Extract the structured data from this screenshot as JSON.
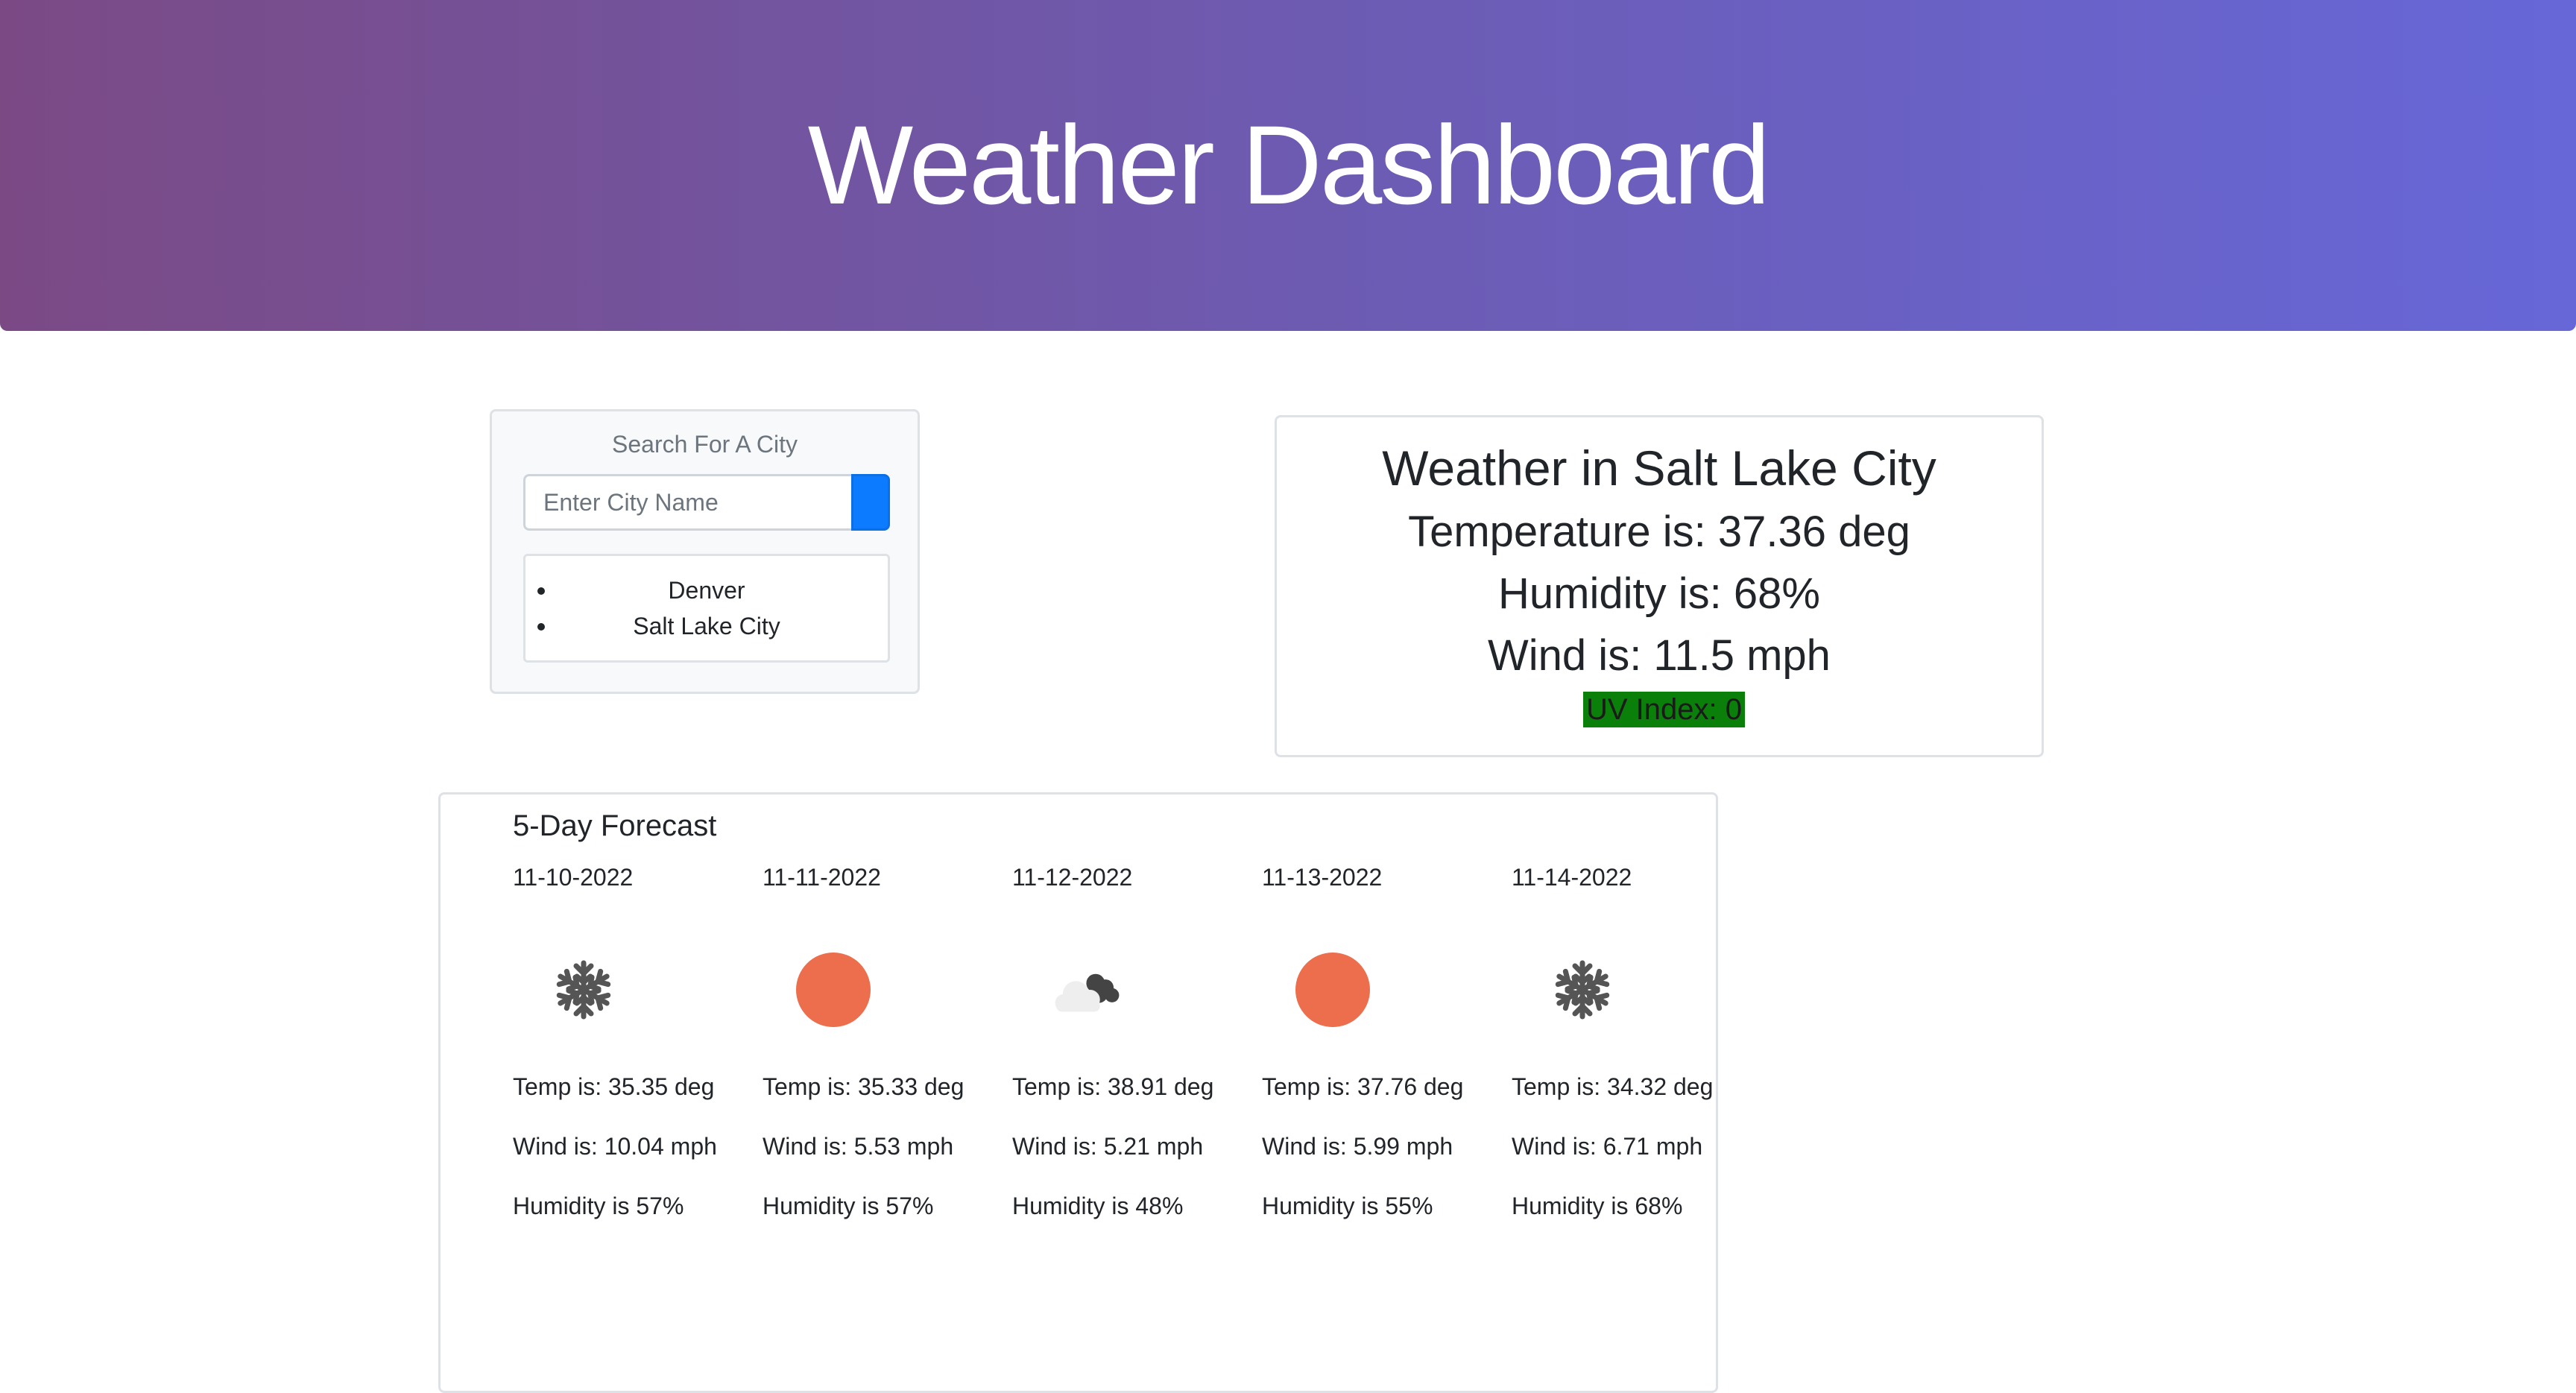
{
  "header": {
    "title": "Weather Dashboard"
  },
  "search": {
    "title": "Search For A City",
    "placeholder": "Enter City Name",
    "history": [
      "Denver",
      "Salt Lake City"
    ]
  },
  "current": {
    "title": "Weather in Salt Lake City",
    "temperature": "Temperature is: 37.36 deg",
    "humidity": "Humidity is: 68%",
    "wind": "Wind is: 11.5 mph",
    "uv": "UV Index: 0",
    "uv_color": "#0a7f0a"
  },
  "forecast": {
    "title": "5-Day Forecast",
    "days": [
      {
        "date": "11-10-2022",
        "icon": "snowflake-icon",
        "temp": "Temp is: 35.35 deg",
        "wind": "Wind is: 10.04 mph",
        "humidity": "Humidity is 57%"
      },
      {
        "date": "11-11-2022",
        "icon": "sun-icon",
        "temp": "Temp is: 35.33 deg",
        "wind": "Wind is: 5.53 mph",
        "humidity": "Humidity is 57%"
      },
      {
        "date": "11-12-2022",
        "icon": "clouds-icon",
        "temp": "Temp is: 38.91 deg",
        "wind": "Wind is: 5.21 mph",
        "humidity": "Humidity is 48%"
      },
      {
        "date": "11-13-2022",
        "icon": "sun-icon",
        "temp": "Temp is: 37.76 deg",
        "wind": "Wind is: 5.99 mph",
        "humidity": "Humidity is 55%"
      },
      {
        "date": "11-14-2022",
        "icon": "snowflake-icon",
        "temp": "Temp is: 34.32 deg",
        "wind": "Wind is: 6.71 mph",
        "humidity": "Humidity is 68%"
      }
    ]
  },
  "colors": {
    "header_gradient_start": "#7b4a85",
    "header_gradient_end": "#6767d8",
    "search_button": "#0d7bff",
    "sun": "#ec6e4c"
  }
}
